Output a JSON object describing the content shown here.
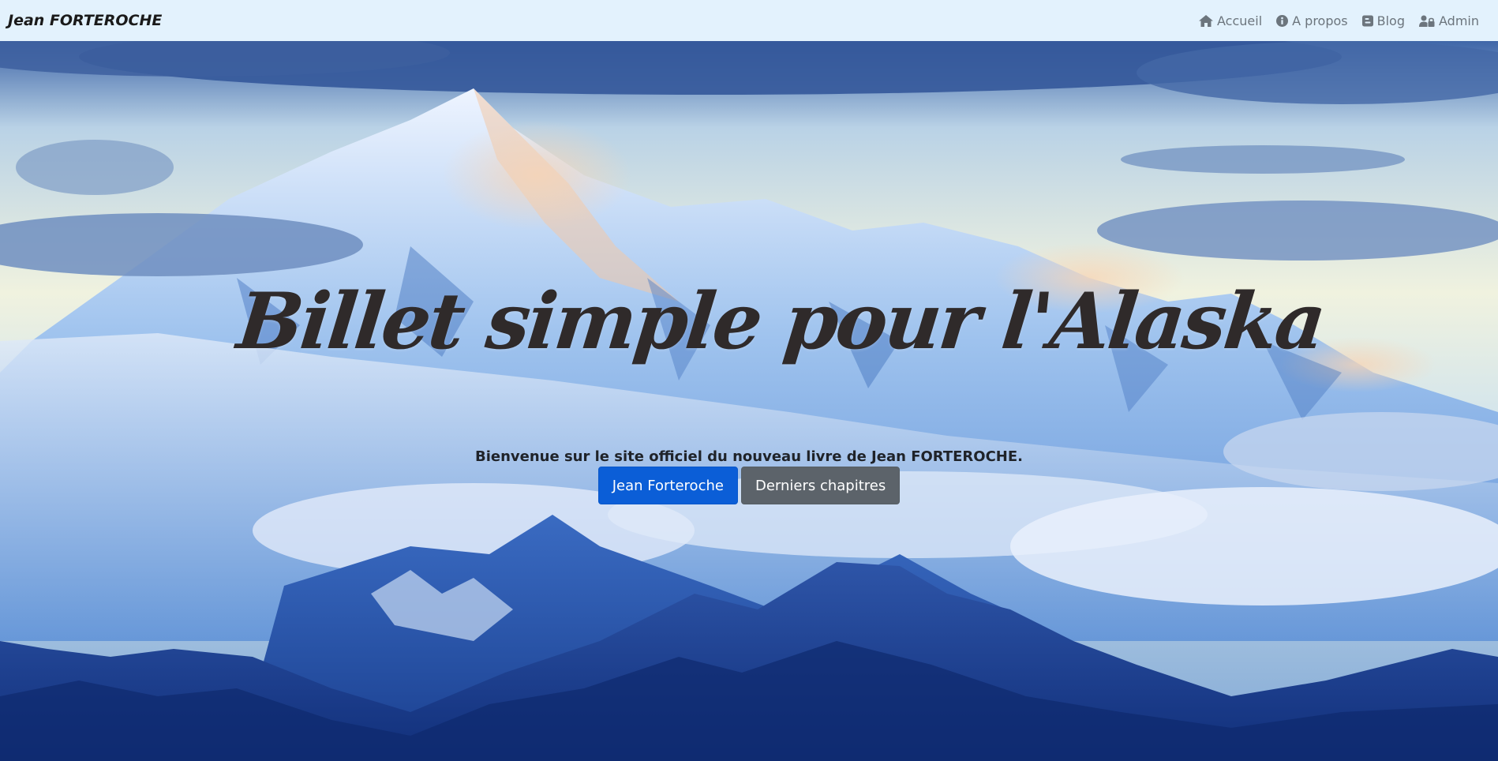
{
  "navbar": {
    "brand": "Jean FORTEROCHE",
    "links": [
      {
        "label": "Accueil",
        "icon": "home-icon"
      },
      {
        "label": "A propos",
        "icon": "info-circle-icon"
      },
      {
        "label": "Blog",
        "icon": "blogger-icon"
      },
      {
        "label": "Admin",
        "icon": "user-lock-icon"
      }
    ]
  },
  "hero": {
    "title": "Billet simple pour l'Alaska",
    "lead": "Bienvenue sur le site officiel du nouveau livre de Jean FORTEROCHE.",
    "buttons": [
      {
        "label": "Jean Forteroche",
        "style": "primary"
      },
      {
        "label": "Derniers chapitres",
        "style": "secondary"
      }
    ],
    "background": "snowy mountain landscape"
  },
  "colors": {
    "navbar_bg": "#e3f2fd",
    "primary": "#0b5ed7",
    "secondary": "#5c636a",
    "title": "#2f2a2a",
    "nav_link": "#6c757d"
  }
}
